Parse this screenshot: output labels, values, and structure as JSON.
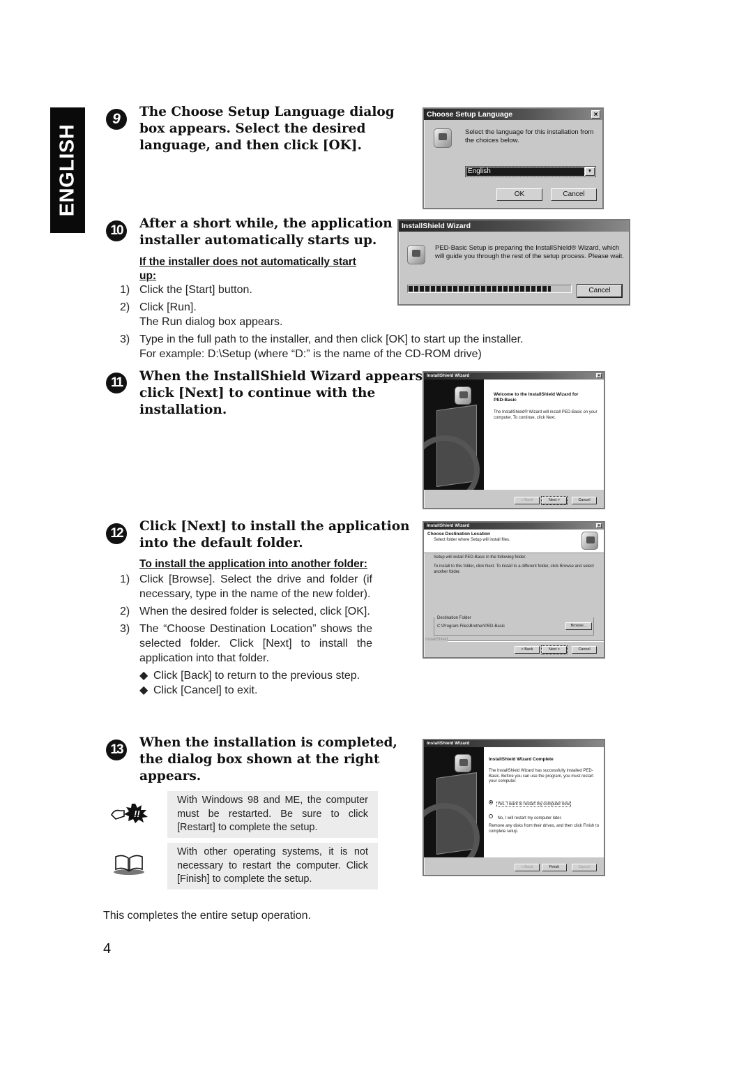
{
  "side_tab": {
    "label": "ENGLISH"
  },
  "steps": [
    {
      "number": "9",
      "heading_lines": [
        "The Choose Setup Language dialog",
        "box appears. Select the desired",
        "language, and then click [OK]."
      ]
    },
    {
      "number": "10",
      "heading_lines": [
        "After a short while, the application",
        "installer automatically starts up."
      ],
      "subheading": "If the installer does not automatically start up:",
      "items": [
        {
          "num": "1)",
          "text": "Click the [Start] button."
        },
        {
          "num": "2)",
          "text": "Click [Run].",
          "extra": "The Run dialog box appears."
        },
        {
          "num": "3)",
          "text": "Type in the full path to the installer, and then click [OK] to start up the installer.",
          "extra": "For example: D:\\Setup (where “D:” is the name of the CD-ROM drive)"
        }
      ]
    },
    {
      "number": "11",
      "heading_lines": [
        "When the InstallShield Wizard appears,",
        "click [Next] to continue with the",
        "installation."
      ]
    },
    {
      "number": "12",
      "heading_lines": [
        "Click [Next] to install the application",
        "into the default folder."
      ],
      "subheading": "To install the application into another folder:",
      "items": [
        {
          "num": "1)",
          "text": "Click [Browse]. Select the drive and folder (if necessary, type in the name of the new folder)."
        },
        {
          "num": "2)",
          "text": "When the desired folder is selected, click [OK]."
        },
        {
          "num": "3)",
          "text": "The “Choose Destination Location” shows the selected folder. Click [Next] to install the application into that folder."
        }
      ],
      "bullets": [
        "Click [Back] to return to the previous step.",
        "Click [Cancel] to exit."
      ]
    },
    {
      "number": "13",
      "heading_lines": [
        "When the installation is completed,",
        "the dialog box shown at the right",
        "appears."
      ],
      "notes": [
        {
          "icon": "caution-icon",
          "text": "With Windows 98 and ME, the computer must be restarted. Be sure to click [Restart] to complete the setup."
        },
        {
          "icon": "book-icon",
          "text": "With other operating systems, it is not necessary to restart the computer. Click [Finish] to complete the setup."
        }
      ]
    }
  ],
  "dialogs": {
    "choose_language": {
      "title": "Choose Setup Language",
      "close": "×",
      "message": "Select the language for this installation from the choices below.",
      "selected_language": "English",
      "ok": "OK",
      "cancel": "Cancel"
    },
    "preparing": {
      "title": "InstallShield Wizard",
      "message": "PED-Basic Setup is preparing the InstallShield® Wizard, which will guide you through the rest of the setup process. Please wait.",
      "progress_percent": 88,
      "cancel": "Cancel"
    },
    "welcome": {
      "title": "InstallShield Wizard",
      "close": "×",
      "heading": "Welcome to the InstallShield Wizard for PED-Basic",
      "message": "The InstallShield® Wizard will install PED-Basic on your computer. To continue, click Next.",
      "back": "< Back",
      "next": "Next >",
      "cancel": "Cancel"
    },
    "destination": {
      "title": "InstallShield Wizard",
      "close": "×",
      "heading": "Choose Destination Location",
      "subheading": "Select folder where Setup will install files.",
      "line1": "Setup will install PED-Basic in the following folder.",
      "line2": "To install to this folder, click Next. To install to a different folder, click Browse and select another folder.",
      "group_label": "Destination Folder",
      "path": "C:\\Program Files\\Brother\\PED-Basic",
      "browse": "Browse...",
      "brand": "InstallShield",
      "back": "< Back",
      "next": "Next >",
      "cancel": "Cancel"
    },
    "complete": {
      "title": "InstallShield Wizard",
      "heading": "InstallShield Wizard Complete",
      "message": "The InstallShield Wizard has successfully installed PED-Basic. Before you can use the program, you must restart your computer.",
      "option_yes": "Yes, I want to restart my computer now.",
      "option_no": "No, I will restart my computer later.",
      "footer": "Remove any disks from their drives, and then click Finish to complete setup.",
      "back": "< Back",
      "finish": "Finish",
      "cancel": "Cancel"
    }
  },
  "closing_text": "This completes the entire setup operation.",
  "page_number": "4"
}
